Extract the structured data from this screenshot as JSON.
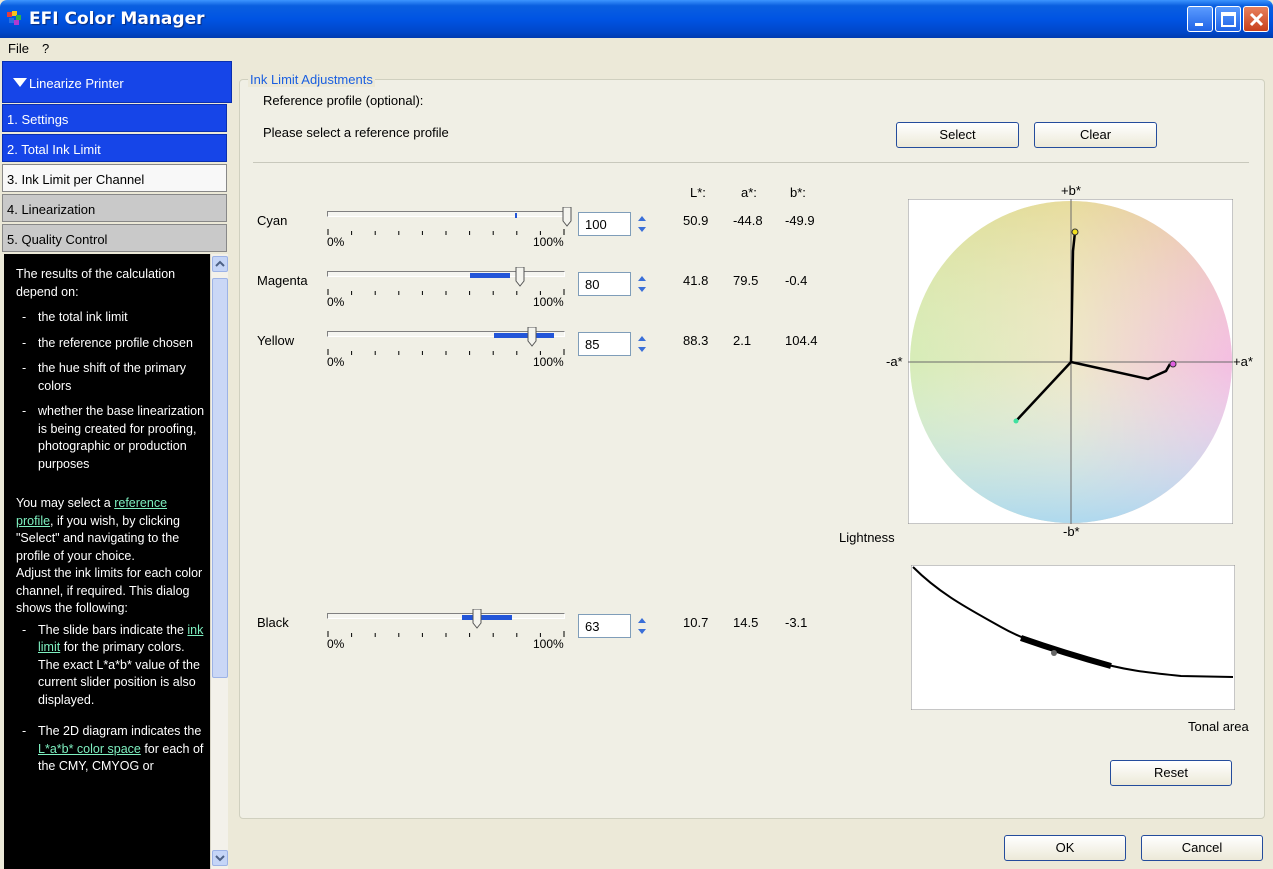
{
  "window": {
    "title": "EFI Color Manager"
  },
  "menu": {
    "file": "File",
    "help": "?"
  },
  "nav": {
    "header": "Linearize Printer",
    "items": [
      {
        "label": "1. Settings"
      },
      {
        "label": "2. Total Ink Limit"
      },
      {
        "label": "3. Ink Limit per Channel"
      },
      {
        "label": "4. Linearization"
      },
      {
        "label": "5. Quality Control"
      }
    ]
  },
  "help": {
    "intro": "The results of the calculation depend on:",
    "bullets1": [
      "the total ink limit",
      "the reference profile chosen",
      "the hue shift of the primary colors",
      "whether the base linearization is being created for proofing, photographic or production purposes"
    ],
    "p2_a": "You may select a ",
    "p2_link": "reference profile",
    "p2_b": ", if you wish, by clicking \"Select\" and navigating to the profile of your choice.",
    "p3": "Adjust the ink limits for each color channel, if required. This dialog shows the following:",
    "b3_a": "The slide bars indicate the ",
    "b3_link": "ink limit",
    "b3_b": " for the primary colors. The exact L*a*b* value of the current slider position is also displayed.",
    "b4_a": "The 2D diagram indicates the ",
    "b4_link": "L*a*b* color space",
    "b4_b": " for each of the CMY, CMYOG or"
  },
  "main": {
    "group_title": "Ink Limit Adjustments",
    "ref_label": "Reference profile (optional):",
    "ref_value": "Please select a reference profile",
    "select_btn": "Select",
    "clear_btn": "Clear",
    "col_L": "L*:",
    "col_a": "a*:",
    "col_b": "b*:",
    "tick_min": "0%",
    "tick_max": "100%",
    "channels": [
      {
        "name": "Cyan",
        "value": "100",
        "L": "50.9",
        "a": "-44.8",
        "b": "-49.9",
        "fill": 1.0
      },
      {
        "name": "Magenta",
        "value": "80",
        "L": "41.8",
        "a": "79.5",
        "b": "-0.4",
        "fill": 0.8
      },
      {
        "name": "Yellow",
        "value": "85",
        "L": "88.3",
        "a": "2.1",
        "b": "104.4",
        "fill": 0.85
      },
      {
        "name": "Black",
        "value": "63",
        "L": "10.7",
        "a": "14.5",
        "b": "-3.1",
        "fill": 0.63
      }
    ],
    "ab_chart": {
      "plus_b": "+b*",
      "minus_b": "-b*",
      "plus_a": "+a*",
      "minus_a": "-a*"
    },
    "lightness_label": "Lightness",
    "tonal_label": "Tonal area",
    "reset_btn": "Reset"
  },
  "footer": {
    "ok": "OK",
    "cancel": "Cancel"
  },
  "colors": {
    "nav_blue": "#1645e8",
    "range_blue": "#2255d8",
    "link": "#7ef0c0",
    "legend": "#1a5fe0"
  }
}
